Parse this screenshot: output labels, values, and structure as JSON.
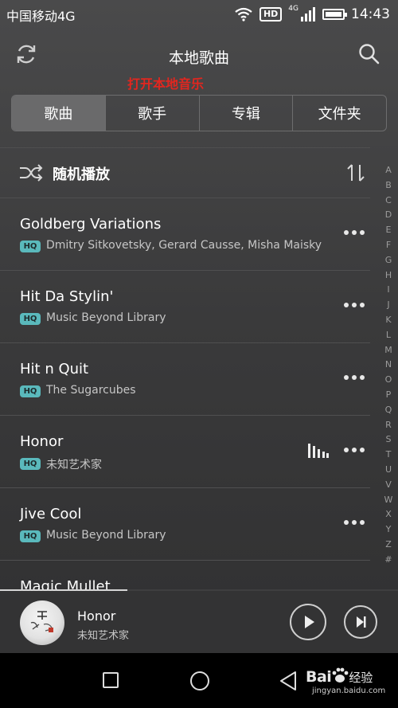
{
  "status_bar": {
    "carrier": "中国移动4G",
    "hd": "HD",
    "network": "4G",
    "time": "14:43"
  },
  "header": {
    "title": "本地歌曲",
    "annotation": "打开本地音乐"
  },
  "tabs": [
    {
      "label": "歌曲",
      "active": true
    },
    {
      "label": "歌手",
      "active": false
    },
    {
      "label": "专辑",
      "active": false
    },
    {
      "label": "文件夹",
      "active": false
    }
  ],
  "shuffle": {
    "label": "随机播放"
  },
  "hq_badge": "HQ",
  "songs": [
    {
      "title": "Goldberg Variations",
      "artist": "Dmitry Sitkovetsky, Gerard Causse, Misha Maisky"
    },
    {
      "title": "Hit Da Stylin'",
      "artist": "Music Beyond Library"
    },
    {
      "title": "Hit n Quit",
      "artist": "The Sugarcubes"
    },
    {
      "title": "Honor",
      "artist": "未知艺术家",
      "playing": true
    },
    {
      "title": "Jive Cool",
      "artist": "Music Beyond Library"
    },
    {
      "title": "Magic Mullet",
      "artist": ""
    }
  ],
  "index_letters": [
    "A",
    "B",
    "C",
    "D",
    "E",
    "F",
    "G",
    "H",
    "I",
    "J",
    "K",
    "L",
    "M",
    "N",
    "O",
    "P",
    "Q",
    "R",
    "S",
    "T",
    "U",
    "V",
    "W",
    "X",
    "Y",
    "Z",
    "#"
  ],
  "now_playing": {
    "title": "Honor",
    "artist": "未知艺术家",
    "progress": 0.32
  },
  "watermark": {
    "logo": "Bai",
    "name": "经验",
    "url": "jingyan.baidu.com"
  },
  "colors": {
    "accent_hq": "#5ab9bc",
    "annotation": "#e2261f"
  }
}
